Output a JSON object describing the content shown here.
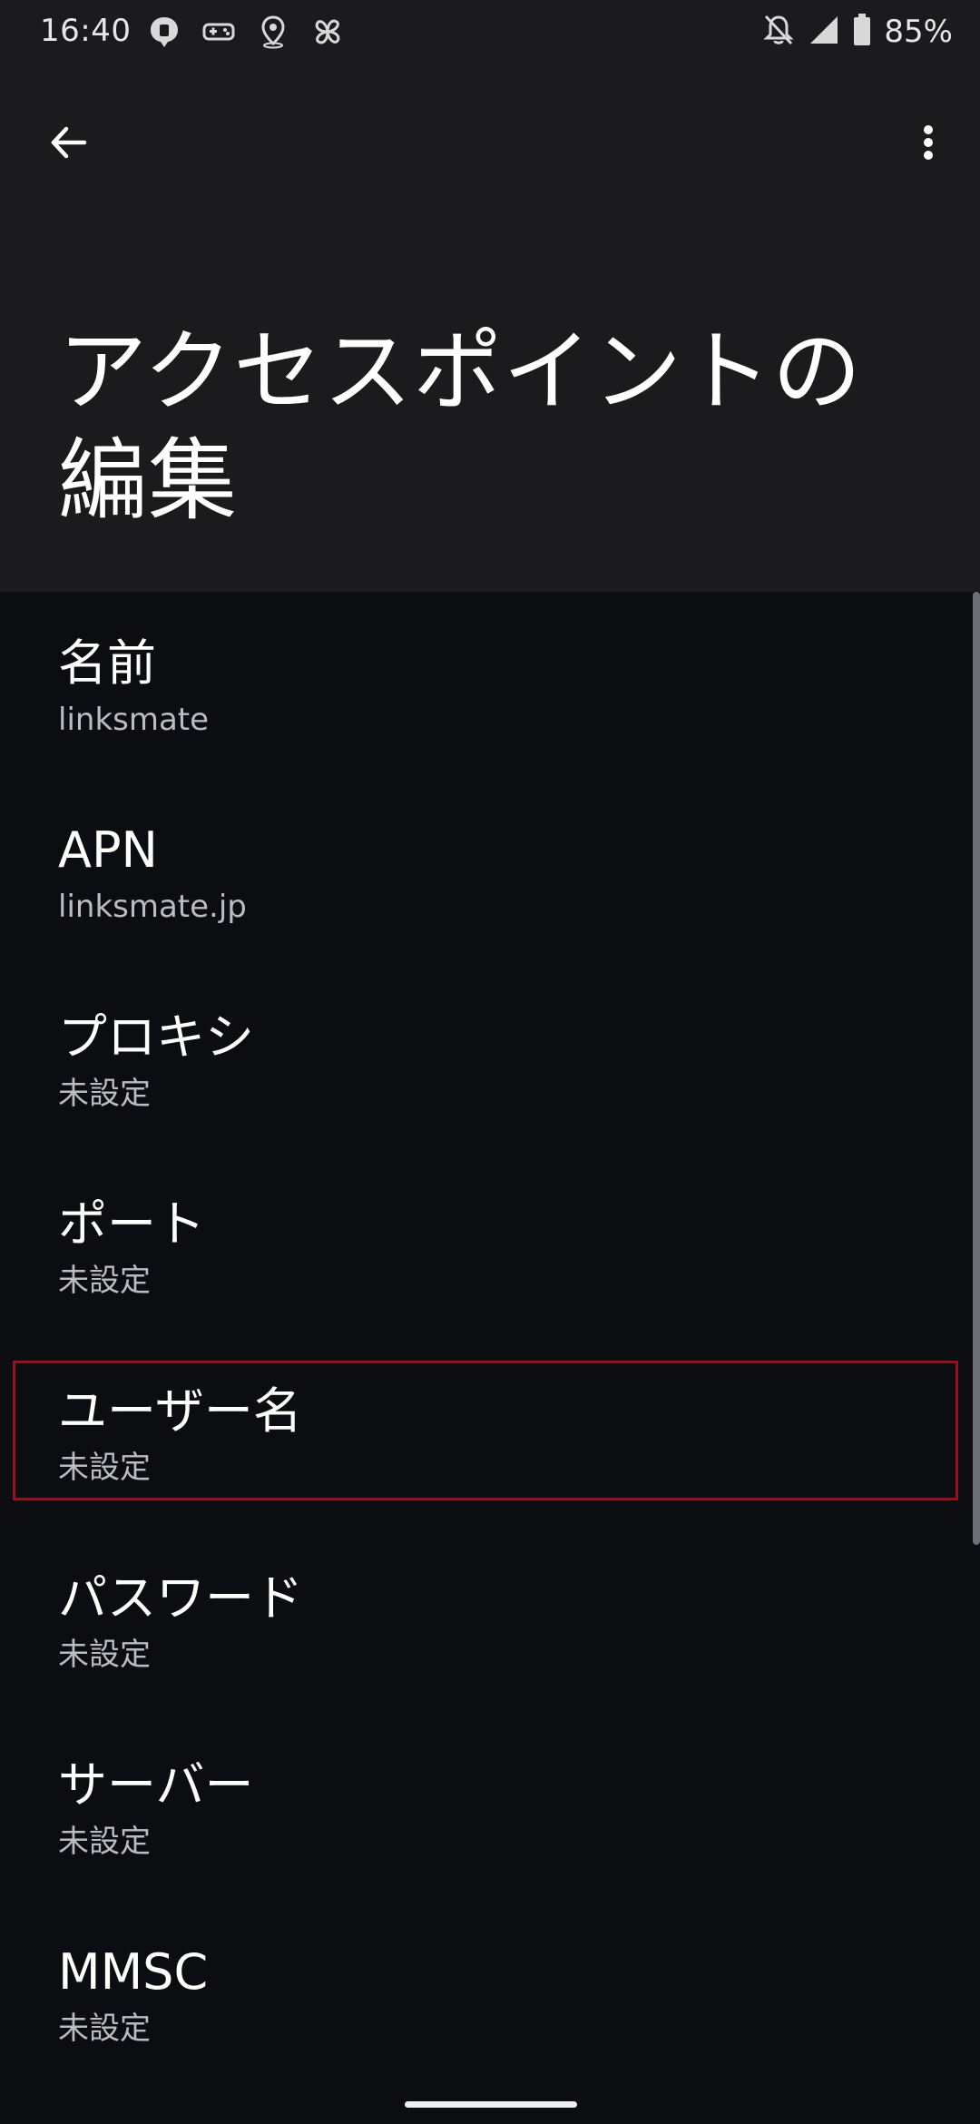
{
  "status_bar": {
    "time": "16:40",
    "battery_percent": "85%",
    "left_icons": [
      "message-bubble-icon",
      "game-controller-icon",
      "location-pin-icon",
      "pinwheel-icon"
    ],
    "right_icons": [
      "notifications-off-icon",
      "signal-icon",
      "battery-icon"
    ]
  },
  "header": {
    "title": "アクセスポイントの編集",
    "back_icon": "arrow-back-icon",
    "more_icon": "more-vert-icon"
  },
  "settings": [
    {
      "title": "名前",
      "value": "linksmate"
    },
    {
      "title": "APN",
      "value": "linksmate.jp"
    },
    {
      "title": "プロキシ",
      "value": "未設定"
    },
    {
      "title": "ポート",
      "value": "未設定"
    },
    {
      "title": "ユーザー名",
      "value": "未設定"
    },
    {
      "title": "パスワード",
      "value": "未設定"
    },
    {
      "title": "サーバー",
      "value": "未設定"
    },
    {
      "title": "MMSC",
      "value": "未設定"
    }
  ],
  "colors": {
    "background": "#0c0d10",
    "header": "#1b1b1e",
    "highlight_border": "#9a0f1f",
    "secondary_text": "#b9bcc3"
  }
}
